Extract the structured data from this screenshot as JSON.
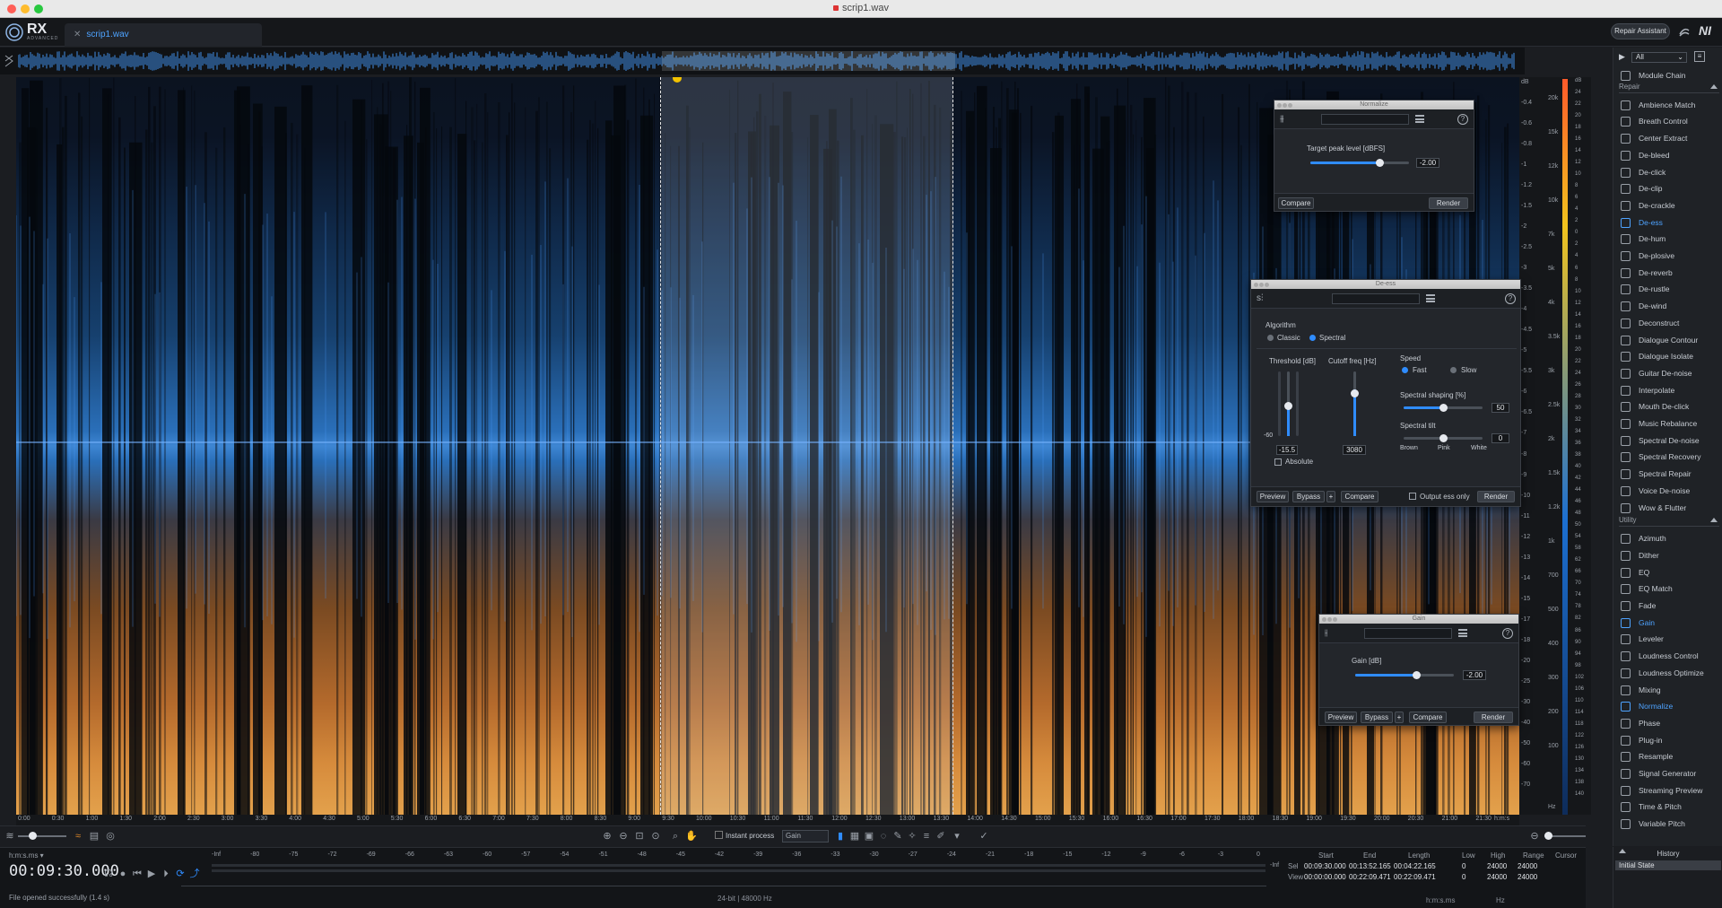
{
  "window": {
    "title": "scrip1.wav"
  },
  "header": {
    "logo_text": "RX",
    "logo_sub": "ADVANCED",
    "file_tab": "scrip1.wav",
    "repair_assistant": "Repair Assistant",
    "brand": "NI"
  },
  "scales": {
    "db_left": [
      "dB",
      "-0.4",
      "-0.6",
      "-0.8",
      "-1",
      "-1.2",
      "-1.5",
      "-2",
      "-2.5",
      "-3",
      "-3.5",
      "-4",
      "-4.5",
      "-5",
      "-5.5",
      "-6",
      "-6.5",
      "-7",
      "-8",
      "-9",
      "-10",
      "-11",
      "-12",
      "-13",
      "-14",
      "-15",
      "-17",
      "-18",
      "-20",
      "-25",
      "-30",
      "-40",
      "-50",
      "-60",
      "-70"
    ],
    "freq": [
      "20k",
      "15k",
      "12k",
      "10k",
      "7k",
      "5k",
      "4k",
      "3.5k",
      "3k",
      "2.5k",
      "2k",
      "1.5k",
      "1.2k",
      "1k",
      "700",
      "500",
      "400",
      "300",
      "200",
      "100",
      "Hz"
    ],
    "db_right": [
      "dB",
      "24",
      "22",
      "20",
      "18",
      "16",
      "14",
      "12",
      "10",
      "8",
      "6",
      "4",
      "2",
      "0",
      "2",
      "4",
      "6",
      "8",
      "10",
      "12",
      "14",
      "16",
      "18",
      "20",
      "22",
      "24",
      "26",
      "28",
      "30",
      "32",
      "34",
      "36",
      "38",
      "40",
      "42",
      "44",
      "46",
      "48",
      "50",
      "54",
      "58",
      "62",
      "66",
      "70",
      "74",
      "78",
      "82",
      "86",
      "90",
      "94",
      "98",
      "102",
      "106",
      "110",
      "114",
      "118",
      "122",
      "126",
      "130",
      "134",
      "138",
      "140"
    ],
    "time": [
      "0:00",
      "0:30",
      "1:00",
      "1:30",
      "2:00",
      "2:30",
      "3:00",
      "3:30",
      "4:00",
      "4:30",
      "5:00",
      "5:30",
      "6:00",
      "6:30",
      "7:00",
      "7:30",
      "8:00",
      "8:30",
      "9:00",
      "9:30",
      "10:00",
      "10:30",
      "11:00",
      "11:30",
      "12:00",
      "12:30",
      "13:00",
      "13:30",
      "14:00",
      "14:30",
      "15:00",
      "15:30",
      "16:00",
      "16:30",
      "17:00",
      "17:30",
      "18:00",
      "18:30",
      "19:00",
      "19:30",
      "20:00",
      "20:30",
      "21:00",
      "21:30"
    ],
    "time_unit": "h:m:s"
  },
  "toolbar": {
    "instant_process": "Instant process",
    "gain_select": "Gain"
  },
  "transport": {
    "time_format": "h:m:s.ms",
    "time_display": "00:09:30.000",
    "status": "File opened successfully (1.4 s)",
    "format": "24-bit | 48000 Hz",
    "meter_labels": [
      "-Inf",
      "-80",
      "-75",
      "-72",
      "-69",
      "-66",
      "-63",
      "-60",
      "-57",
      "-54",
      "-51",
      "-48",
      "-45",
      "-42",
      "-39",
      "-36",
      "-33",
      "-30",
      "-27",
      "-24",
      "-21",
      "-18",
      "-15",
      "-12",
      "-9",
      "-6",
      "-3",
      "0"
    ],
    "meter_end": "-Inf"
  },
  "selection": {
    "headers": [
      "Start",
      "End",
      "Length",
      "Low",
      "High",
      "Range",
      "Cursor"
    ],
    "sel_label": "Sel",
    "view_label": "View",
    "sel": [
      "00:09:30.000",
      "00:13:52.165",
      "00:04:22.165",
      "0",
      "24000",
      "24000"
    ],
    "view": [
      "00:00:00.000",
      "00:22:09.471",
      "00:22:09.471",
      "0",
      "24000",
      "24000"
    ],
    "foot_time": "h:m:s.ms",
    "foot_hz": "Hz"
  },
  "modules": {
    "filter": "All",
    "chain": "Module Chain",
    "repair_title": "Repair",
    "repair": [
      "Ambience Match",
      "Breath Control",
      "Center Extract",
      "De-bleed",
      "De-click",
      "De-clip",
      "De-crackle",
      "De-ess",
      "De-hum",
      "De-plosive",
      "De-reverb",
      "De-rustle",
      "De-wind",
      "Deconstruct",
      "Dialogue Contour",
      "Dialogue Isolate",
      "Guitar De-noise",
      "Interpolate",
      "Mouth De-click",
      "Music Rebalance",
      "Spectral De-noise",
      "Spectral Recovery",
      "Spectral Repair",
      "Voice De-noise",
      "Wow & Flutter"
    ],
    "utility_title": "Utility",
    "utility": [
      "Azimuth",
      "Dither",
      "EQ",
      "EQ Match",
      "Fade",
      "Gain",
      "Leveler",
      "Loudness Control",
      "Loudness Optimize",
      "Mixing",
      "Normalize",
      "Phase",
      "Plug-in",
      "Resample",
      "Signal Generator",
      "Streaming Preview",
      "Time & Pitch",
      "Variable Pitch"
    ],
    "active": [
      "De-ess",
      "Gain",
      "Normalize"
    ]
  },
  "history": {
    "title": "History",
    "item": "Initial State"
  },
  "normalize": {
    "title": "Normalize",
    "param": "Target peak level [dBFS]",
    "value": "-2.00",
    "level": 0.7,
    "compare": "Compare",
    "render": "Render"
  },
  "deess": {
    "title": "De-ess",
    "algorithm": "Algorithm",
    "classic": "Classic",
    "spectral": "Spectral",
    "threshold": "Threshold [dB]",
    "threshold_min": "-60",
    "threshold_val": "-15.5",
    "cutoff": "Cutoff freq [Hz]",
    "cutoff_val": "3080",
    "absolute": "Absolute",
    "speed": "Speed",
    "fast": "Fast",
    "slow": "Slow",
    "shaping": "Spectral shaping [%]",
    "shaping_val": "50",
    "shaping_level": 0.5,
    "tilt": "Spectral tilt",
    "tilt_val": "0",
    "tilt_level": 0.5,
    "brown": "Brown",
    "pink": "Pink",
    "white": "White",
    "preview": "Preview",
    "bypass": "Bypass",
    "plus": "+",
    "compare": "Compare",
    "output_ess": "Output ess only",
    "render": "Render"
  },
  "gain": {
    "title": "Gain",
    "param": "Gain [dB]",
    "value": "-2.00",
    "level": 0.62,
    "preview": "Preview",
    "bypass": "Bypass",
    "plus": "+",
    "compare": "Compare",
    "render": "Render"
  }
}
